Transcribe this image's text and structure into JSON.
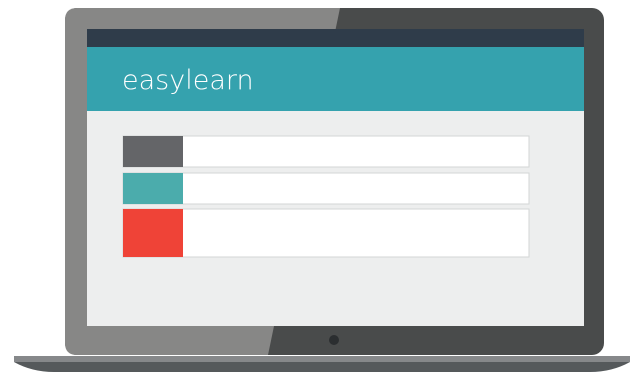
{
  "app": {
    "brand_name": "easylearn"
  },
  "colors": {
    "bezel_light": "#878786",
    "bezel_dark": "#494B4B",
    "top_bar": "#2F3C4A",
    "header_teal": "#35A2AE",
    "content_bg": "#EDEEEE",
    "row_bg": "#FFFFFF",
    "row_border": "#D3D5D6",
    "accent_gray": "#646568",
    "accent_teal": "#4BACAC",
    "accent_red": "#EF4337",
    "base_top": "#86888A",
    "base_bottom": "#55595B",
    "camera": "#2B2E30"
  },
  "rows": [
    {
      "name": "list-row-1",
      "accent": "accent_gray"
    },
    {
      "name": "list-row-2",
      "accent": "accent_teal"
    },
    {
      "name": "list-row-3",
      "accent": "accent_red"
    }
  ]
}
